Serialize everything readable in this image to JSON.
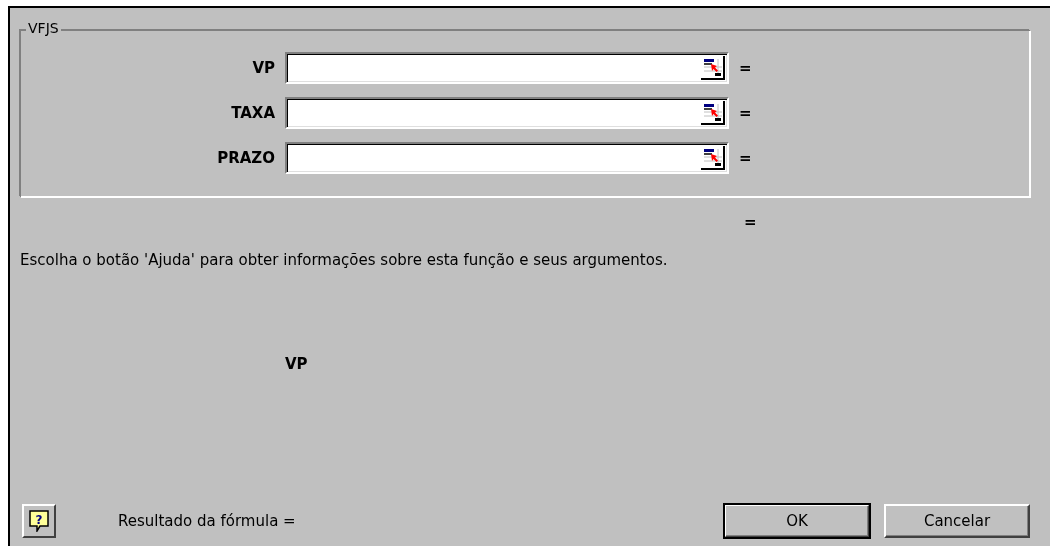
{
  "group": {
    "title": "VFJS",
    "arguments": [
      {
        "label": "VP",
        "result": "="
      },
      {
        "label": "TAXA",
        "result": "="
      },
      {
        "label": "PRAZO",
        "result": "="
      }
    ]
  },
  "help_button": "?",
  "function_result": "=",
  "description": "Escolha o botão 'Ajuda' para obter informações sobre esta função e seus argumentos.",
  "argument_help": "VP",
  "formula_result": "Resultado da fórmula =",
  "buttons": [
    {
      "label": "OK",
      "default": true
    },
    {
      "label": "Cancelar",
      "default": false
    }
  ]
}
